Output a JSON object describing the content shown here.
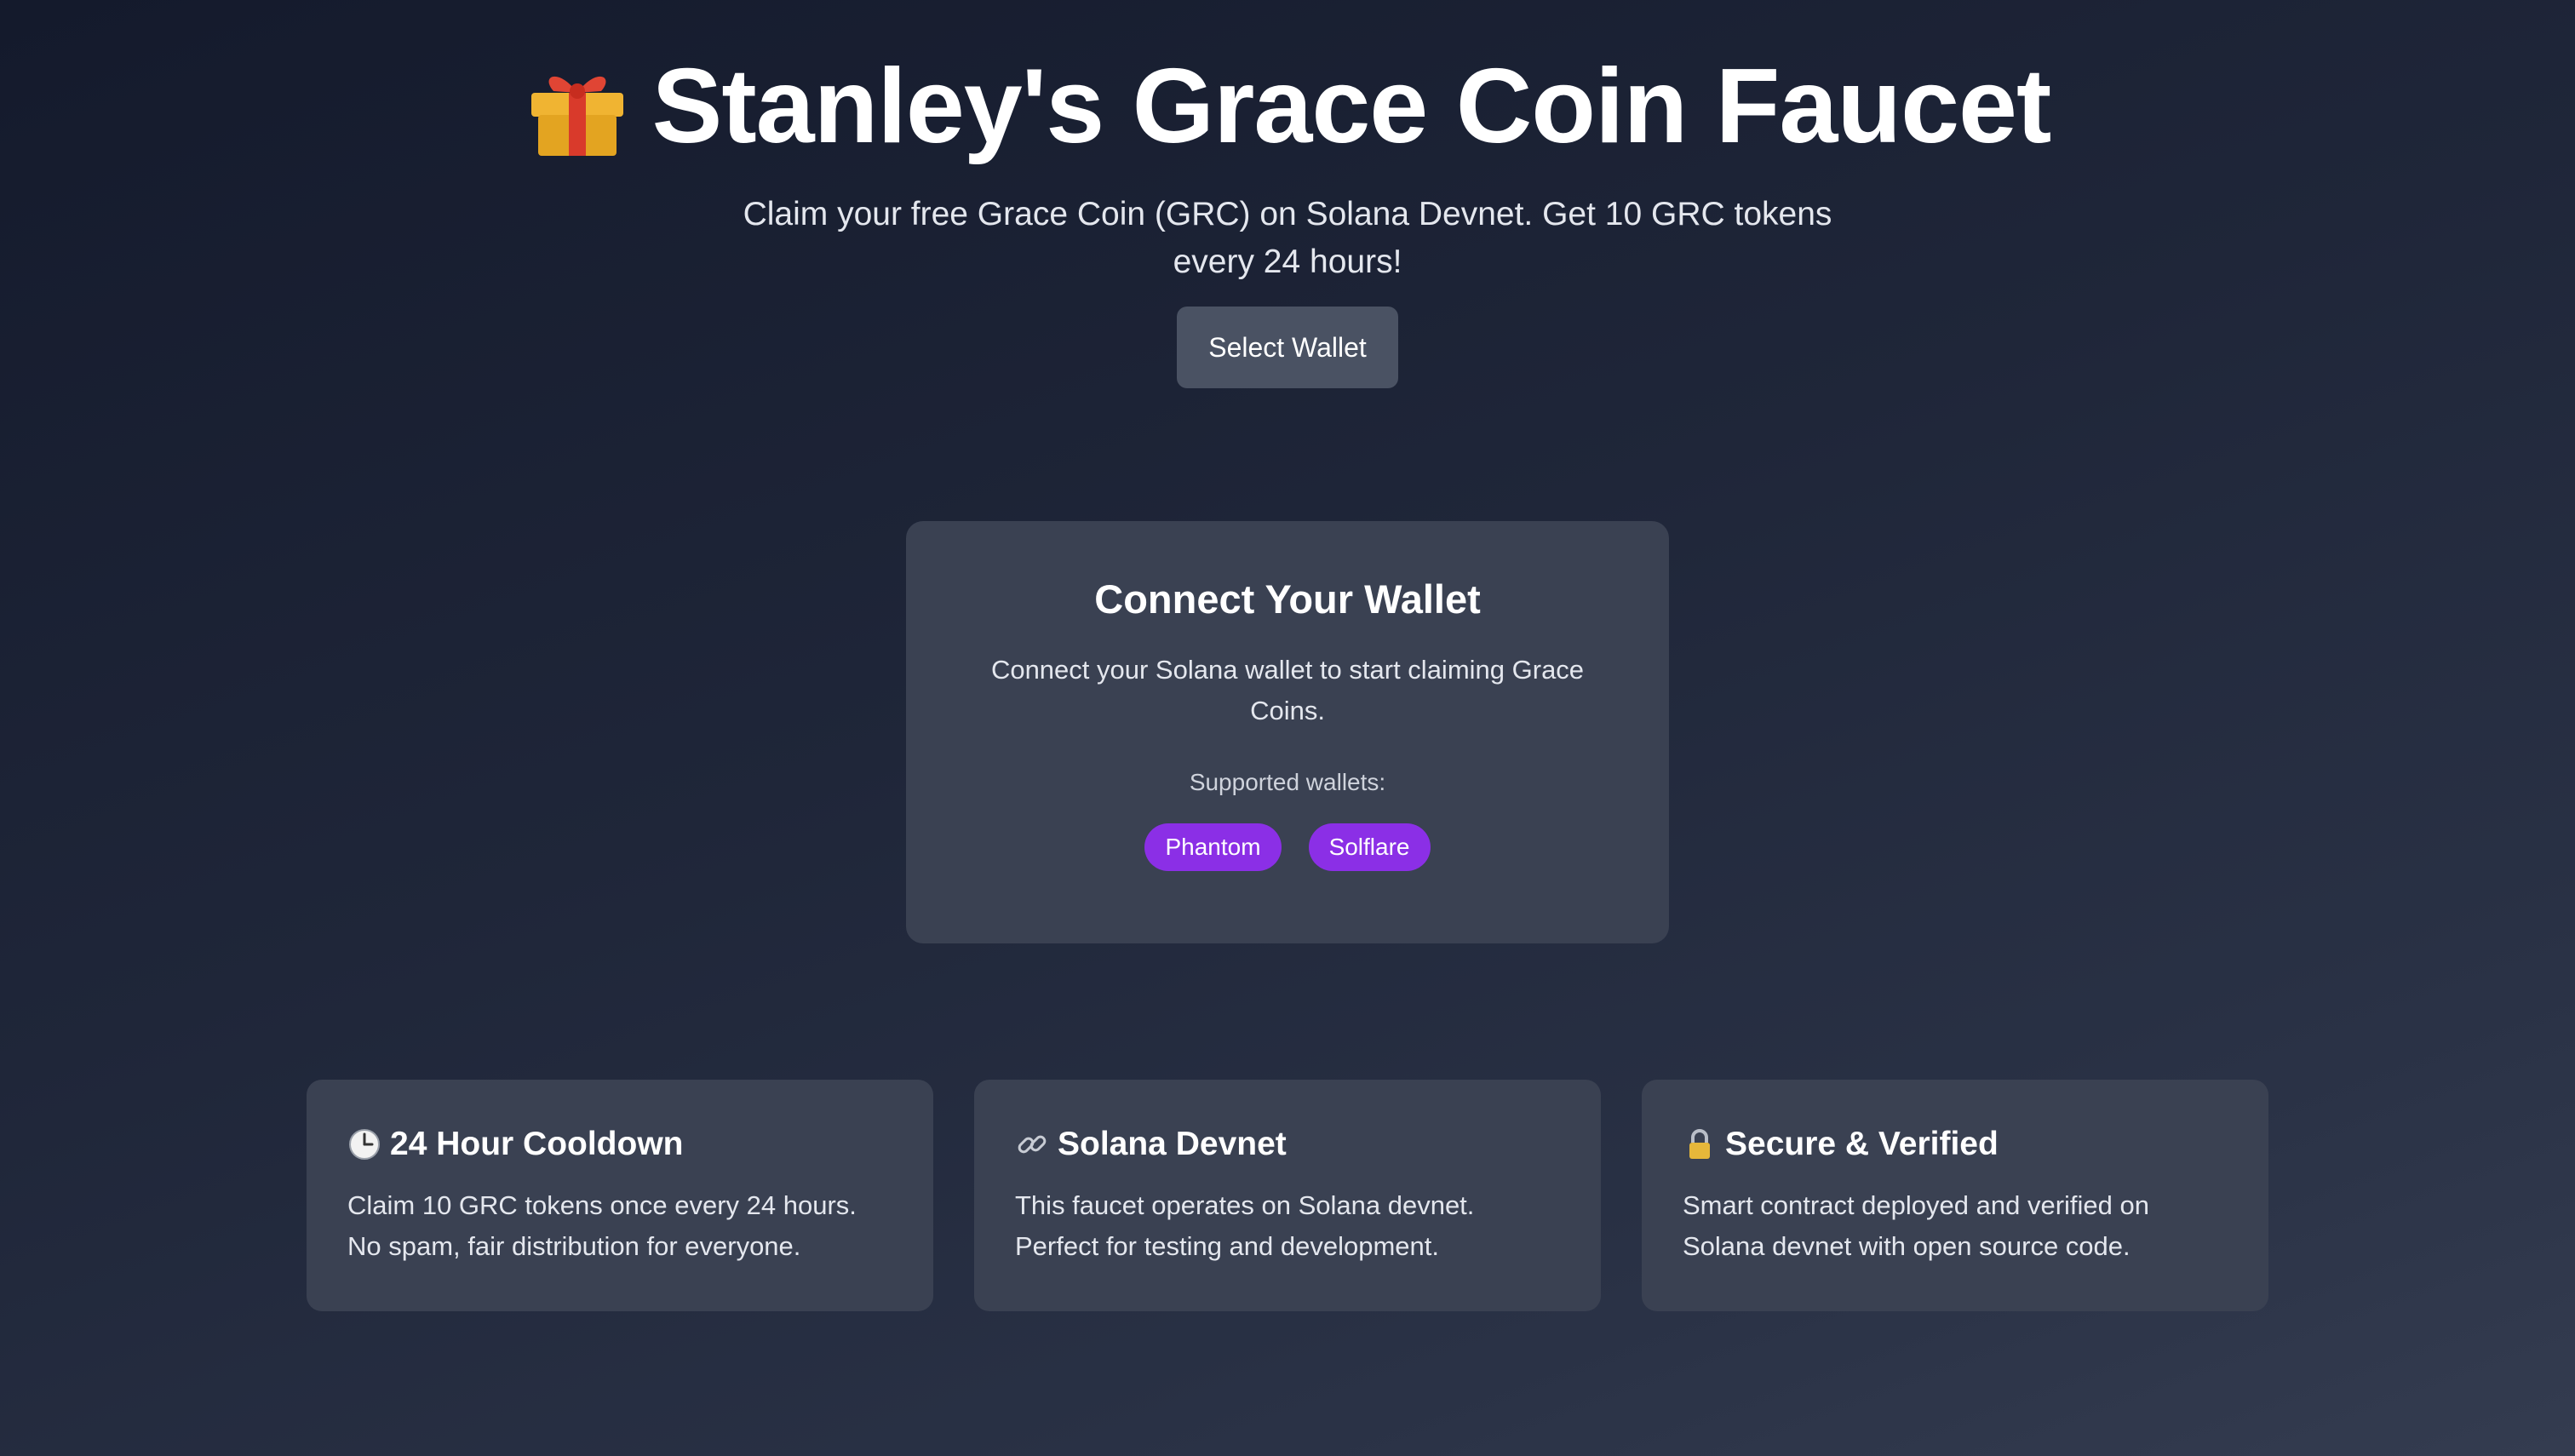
{
  "header": {
    "icon": "gift-icon",
    "title": "Stanley's Grace Coin Faucet",
    "subtitle": "Claim your free Grace Coin (GRC) on Solana Devnet. Get 10 GRC tokens every 24 hours!",
    "select_wallet_label": "Select Wallet"
  },
  "connect_card": {
    "title": "Connect Your Wallet",
    "text": "Connect your Solana wallet to start claiming Grace Coins.",
    "supported_label": "Supported wallets:",
    "wallets": [
      "Phantom",
      "Solflare"
    ]
  },
  "features": [
    {
      "icon": "clock-icon",
      "title": "24 Hour Cooldown",
      "desc": "Claim 10 GRC tokens once every 24 hours. No spam, fair distribution for everyone."
    },
    {
      "icon": "link-icon",
      "title": "Solana Devnet",
      "desc": "This faucet operates on Solana devnet. Perfect for testing and development."
    },
    {
      "icon": "lock-icon",
      "title": "Secure & Verified",
      "desc": "Smart contract deployed and verified on Solana devnet with open source code."
    }
  ],
  "colors": {
    "background_start": "#141a2c",
    "background_end": "#343c50",
    "card": "#3a4152",
    "button": "#4a5263",
    "wallet_tag": "#8b2fe6"
  }
}
